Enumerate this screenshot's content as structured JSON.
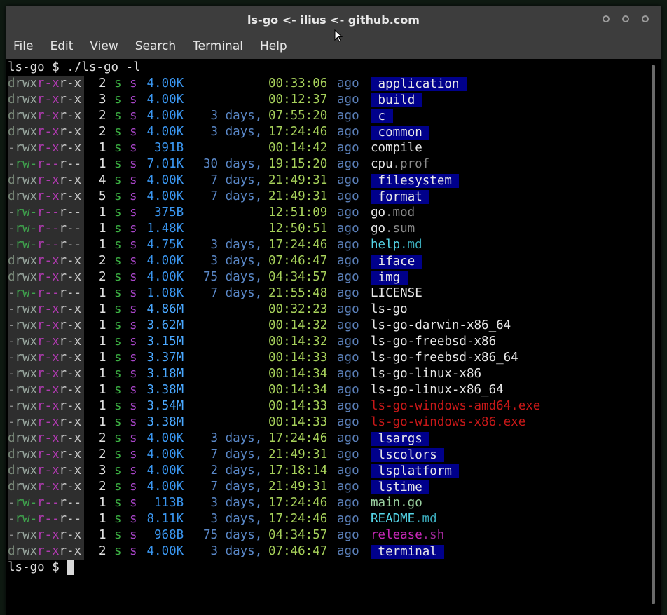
{
  "window": {
    "title": "ls-go <- ilius <- github.com"
  },
  "menu": [
    "File",
    "Edit",
    "View",
    "Search",
    "Terminal",
    "Help"
  ],
  "terminal": {
    "command_line": "ls-go $ ./ls-go -l",
    "prompt": "ls-go $ ",
    "rows": [
      {
        "type": "d",
        "perm": [
          "rwx",
          "r-x",
          "r-x"
        ],
        "links": "2",
        "user": "s",
        "group": "s",
        "size": "4.00K",
        "days": "",
        "time": "00:33:06",
        "ago": "ago",
        "name": "application",
        "ext": "",
        "kind": "dir"
      },
      {
        "type": "d",
        "perm": [
          "rwx",
          "r-x",
          "r-x"
        ],
        "links": "3",
        "user": "s",
        "group": "s",
        "size": "4.00K",
        "days": "",
        "time": "00:12:37",
        "ago": "ago",
        "name": "build",
        "ext": "",
        "kind": "dir"
      },
      {
        "type": "d",
        "perm": [
          "rwx",
          "r-x",
          "r-x"
        ],
        "links": "2",
        "user": "s",
        "group": "s",
        "size": "4.00K",
        "days": "3 days,",
        "time": "07:55:20",
        "ago": "ago",
        "name": "c",
        "ext": "",
        "kind": "dir"
      },
      {
        "type": "d",
        "perm": [
          "rwx",
          "r-x",
          "r-x"
        ],
        "links": "2",
        "user": "s",
        "group": "s",
        "size": "4.00K",
        "days": "3 days,",
        "time": "17:24:46",
        "ago": "ago",
        "name": "common",
        "ext": "",
        "kind": "dir"
      },
      {
        "type": "-",
        "perm": [
          "rwx",
          "r-x",
          "r-x"
        ],
        "links": "1",
        "user": "s",
        "group": "s",
        "size": "391B",
        "days": "",
        "time": "00:14:42",
        "ago": "ago",
        "name": "compile",
        "ext": "",
        "kind": "file"
      },
      {
        "type": "-",
        "perm": [
          "rw-",
          "r--",
          "r--"
        ],
        "links": "1",
        "user": "s",
        "group": "s",
        "size": "7.01K",
        "days": "30 days,",
        "time": "19:15:20",
        "ago": "ago",
        "name": "cpu",
        "ext": ".prof",
        "kind": "file"
      },
      {
        "type": "d",
        "perm": [
          "rwx",
          "r-x",
          "r-x"
        ],
        "links": "4",
        "user": "s",
        "group": "s",
        "size": "4.00K",
        "days": "7 days,",
        "time": "21:49:31",
        "ago": "ago",
        "name": "filesystem",
        "ext": "",
        "kind": "dir"
      },
      {
        "type": "d",
        "perm": [
          "rwx",
          "r-x",
          "r-x"
        ],
        "links": "5",
        "user": "s",
        "group": "s",
        "size": "4.00K",
        "days": "7 days,",
        "time": "21:49:31",
        "ago": "ago",
        "name": "format",
        "ext": "",
        "kind": "dir"
      },
      {
        "type": "-",
        "perm": [
          "rw-",
          "r--",
          "r--"
        ],
        "links": "1",
        "user": "s",
        "group": "s",
        "size": "375B",
        "days": "",
        "time": "12:51:09",
        "ago": "ago",
        "name": "go",
        "ext": ".mod",
        "kind": "file"
      },
      {
        "type": "-",
        "perm": [
          "rw-",
          "r--",
          "r--"
        ],
        "links": "1",
        "user": "s",
        "group": "s",
        "size": "1.48K",
        "days": "",
        "time": "12:50:51",
        "ago": "ago",
        "name": "go",
        "ext": ".sum",
        "kind": "file"
      },
      {
        "type": "-",
        "perm": [
          "rw-",
          "r--",
          "r--"
        ],
        "links": "1",
        "user": "s",
        "group": "s",
        "size": "4.75K",
        "days": "3 days,",
        "time": "17:24:46",
        "ago": "ago",
        "name": "help",
        "ext": ".md",
        "kind": "md"
      },
      {
        "type": "d",
        "perm": [
          "rwx",
          "r-x",
          "r-x"
        ],
        "links": "2",
        "user": "s",
        "group": "s",
        "size": "4.00K",
        "days": "3 days,",
        "time": "07:46:47",
        "ago": "ago",
        "name": "iface",
        "ext": "",
        "kind": "dir"
      },
      {
        "type": "d",
        "perm": [
          "rwx",
          "r-x",
          "r-x"
        ],
        "links": "2",
        "user": "s",
        "group": "s",
        "size": "4.00K",
        "days": "75 days,",
        "time": "04:34:57",
        "ago": "ago",
        "name": "img",
        "ext": "",
        "kind": "dir"
      },
      {
        "type": "-",
        "perm": [
          "rw-",
          "r--",
          "r--"
        ],
        "links": "1",
        "user": "s",
        "group": "s",
        "size": "1.08K",
        "days": "7 days,",
        "time": "21:55:48",
        "ago": "ago",
        "name": "LICENSE",
        "ext": "",
        "kind": "file"
      },
      {
        "type": "-",
        "perm": [
          "rwx",
          "r-x",
          "r-x"
        ],
        "links": "1",
        "user": "s",
        "group": "s",
        "size": "4.86M",
        "days": "",
        "time": "00:32:23",
        "ago": "ago",
        "name": "ls-go",
        "ext": "",
        "kind": "file"
      },
      {
        "type": "-",
        "perm": [
          "rwx",
          "r-x",
          "r-x"
        ],
        "links": "1",
        "user": "s",
        "group": "s",
        "size": "3.62M",
        "days": "",
        "time": "00:14:32",
        "ago": "ago",
        "name": "ls-go-darwin-x86_64",
        "ext": "",
        "kind": "file"
      },
      {
        "type": "-",
        "perm": [
          "rwx",
          "r-x",
          "r-x"
        ],
        "links": "1",
        "user": "s",
        "group": "s",
        "size": "3.15M",
        "days": "",
        "time": "00:14:32",
        "ago": "ago",
        "name": "ls-go-freebsd-x86",
        "ext": "",
        "kind": "file"
      },
      {
        "type": "-",
        "perm": [
          "rwx",
          "r-x",
          "r-x"
        ],
        "links": "1",
        "user": "s",
        "group": "s",
        "size": "3.37M",
        "days": "",
        "time": "00:14:33",
        "ago": "ago",
        "name": "ls-go-freebsd-x86_64",
        "ext": "",
        "kind": "file"
      },
      {
        "type": "-",
        "perm": [
          "rwx",
          "r-x",
          "r-x"
        ],
        "links": "1",
        "user": "s",
        "group": "s",
        "size": "3.18M",
        "days": "",
        "time": "00:14:34",
        "ago": "ago",
        "name": "ls-go-linux-x86",
        "ext": "",
        "kind": "file"
      },
      {
        "type": "-",
        "perm": [
          "rwx",
          "r-x",
          "r-x"
        ],
        "links": "1",
        "user": "s",
        "group": "s",
        "size": "3.38M",
        "days": "",
        "time": "00:14:34",
        "ago": "ago",
        "name": "ls-go-linux-x86_64",
        "ext": "",
        "kind": "file"
      },
      {
        "type": "-",
        "perm": [
          "rwx",
          "r-x",
          "r-x"
        ],
        "links": "1",
        "user": "s",
        "group": "s",
        "size": "3.54M",
        "days": "",
        "time": "00:14:33",
        "ago": "ago",
        "name": "ls-go-windows-amd64.exe",
        "ext": "",
        "kind": "exe"
      },
      {
        "type": "-",
        "perm": [
          "rwx",
          "r-x",
          "r-x"
        ],
        "links": "1",
        "user": "s",
        "group": "s",
        "size": "3.38M",
        "days": "",
        "time": "00:14:33",
        "ago": "ago",
        "name": "ls-go-windows-x86.exe",
        "ext": "",
        "kind": "exe"
      },
      {
        "type": "d",
        "perm": [
          "rwx",
          "r-x",
          "r-x"
        ],
        "links": "2",
        "user": "s",
        "group": "s",
        "size": "4.00K",
        "days": "3 days,",
        "time": "17:24:46",
        "ago": "ago",
        "name": "lsargs",
        "ext": "",
        "kind": "dir"
      },
      {
        "type": "d",
        "perm": [
          "rwx",
          "r-x",
          "r-x"
        ],
        "links": "2",
        "user": "s",
        "group": "s",
        "size": "4.00K",
        "days": "7 days,",
        "time": "21:49:31",
        "ago": "ago",
        "name": "lscolors",
        "ext": "",
        "kind": "dir"
      },
      {
        "type": "d",
        "perm": [
          "rwx",
          "r-x",
          "r-x"
        ],
        "links": "3",
        "user": "s",
        "group": "s",
        "size": "4.00K",
        "days": "2 days,",
        "time": "17:18:14",
        "ago": "ago",
        "name": "lsplatform",
        "ext": "",
        "kind": "dir"
      },
      {
        "type": "d",
        "perm": [
          "rwx",
          "r-x",
          "r-x"
        ],
        "links": "2",
        "user": "s",
        "group": "s",
        "size": "4.00K",
        "days": "7 days,",
        "time": "21:49:31",
        "ago": "ago",
        "name": "lstime",
        "ext": "",
        "kind": "dir"
      },
      {
        "type": "-",
        "perm": [
          "rw-",
          "r--",
          "r--"
        ],
        "links": "1",
        "user": "s",
        "group": "s",
        "size": "113B",
        "days": "3 days,",
        "time": "17:24:46",
        "ago": "ago",
        "name": "main.go",
        "ext": "",
        "kind": "gofile"
      },
      {
        "type": "-",
        "perm": [
          "rw-",
          "r--",
          "r--"
        ],
        "links": "1",
        "user": "s",
        "group": "s",
        "size": "8.11K",
        "days": "3 days,",
        "time": "17:24:46",
        "ago": "ago",
        "name": "README",
        "ext": ".md",
        "kind": "md"
      },
      {
        "type": "-",
        "perm": [
          "rwx",
          "r-x",
          "r-x"
        ],
        "links": "1",
        "user": "s",
        "group": "s",
        "size": "968B",
        "days": "75 days,",
        "time": "04:34:57",
        "ago": "ago",
        "name": "release",
        "ext": ".sh",
        "kind": "sh"
      },
      {
        "type": "d",
        "perm": [
          "rwx",
          "r-x",
          "r-x"
        ],
        "links": "2",
        "user": "s",
        "group": "s",
        "size": "4.00K",
        "days": "3 days,",
        "time": "07:46:47",
        "ago": "ago",
        "name": "terminal",
        "ext": "",
        "kind": "dir"
      }
    ]
  },
  "colors": {
    "title_bar": "#3d3d3d",
    "terminal_bg": "#000000",
    "perm_bg": "#2e2e2e",
    "perm_type": "#8a8a8a",
    "perm_user_exec": "#9aa0a0",
    "perm_user_rw": "#3fa34d",
    "perm_group": "#b13ab1",
    "perm_other": "#c8c8c8",
    "links": "#e0e0e0",
    "user": "#3cb043",
    "group": "#a845c8",
    "size_kb": "#3a96f0",
    "size_bytes": "#3a96f0",
    "size_mb": "#4aa8ff",
    "days": "#5a88c8",
    "time": "#a6d05a",
    "ago": "#5a7fb8",
    "dir_bg": "#00008b",
    "dir_fg": "#e8e8e8",
    "file": "#e8e8e8",
    "ext": "#8a8a8a",
    "md": "#55d6e8",
    "exe": "#c81818",
    "sh": "#c828b8",
    "gofile": "#9ad0a0"
  }
}
